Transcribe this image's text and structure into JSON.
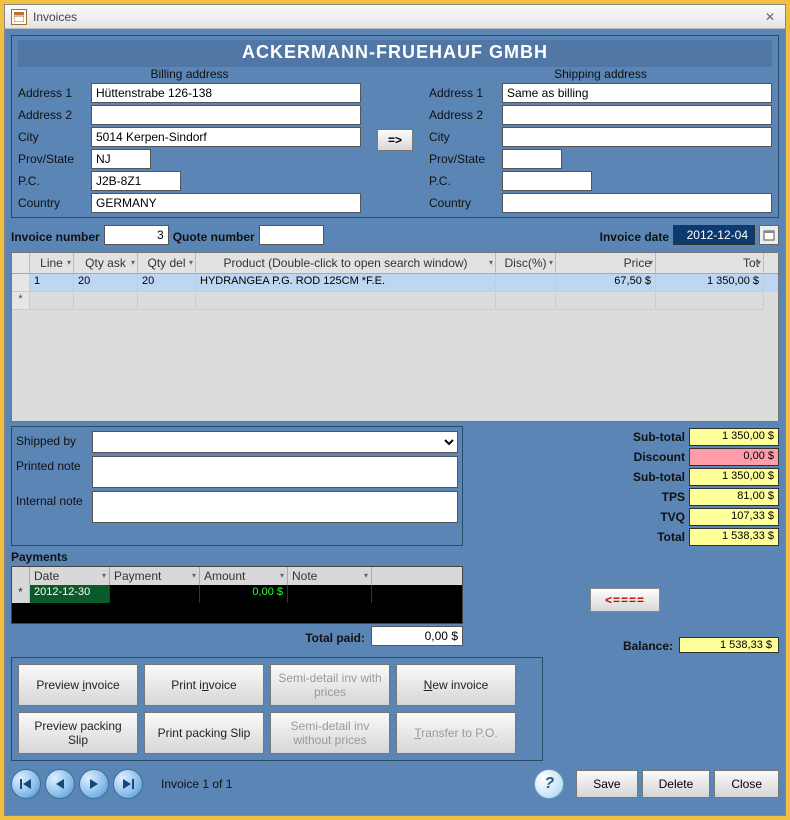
{
  "window": {
    "title": "Invoices",
    "close_glyph": "✕"
  },
  "company_name": "ACKERMANN-FRUEHAUF GMBH",
  "billing": {
    "title": "Billing address",
    "labels": {
      "addr1": "Address 1",
      "addr2": "Address 2",
      "city": "City",
      "prov": "Prov/State",
      "pc": "P.C.",
      "country": "Country"
    },
    "values": {
      "addr1": "Hüttenstrabe 126-138",
      "addr2": "",
      "city": "5014 Kerpen-Sindorf",
      "prov": "NJ",
      "pc": "J2B-8Z1",
      "country": "GERMANY"
    }
  },
  "shipping": {
    "title": "Shipping address",
    "values": {
      "addr1": "Same as billing",
      "addr2": "",
      "city": "",
      "prov": "",
      "pc": "",
      "country": ""
    }
  },
  "copy_arrow": "=>",
  "meta": {
    "invoice_number_label": "Invoice number",
    "invoice_number": "3",
    "quote_number_label": "Quote number",
    "quote_number": "",
    "invoice_date_label": "Invoice date",
    "invoice_date": "2012-12-04"
  },
  "grid": {
    "headers": {
      "line": "Line",
      "qty_ask": "Qty ask",
      "qty_del": "Qty del",
      "product": "Product (Double-click to open search window)",
      "disc": "Disc(%)",
      "price": "Price",
      "tot": "Tot"
    },
    "rows": [
      {
        "line": "1",
        "qty_ask": "20",
        "qty_del": "20",
        "product": "HYDRANGEA P.G. ROD 125CM  *F.E.",
        "disc": "",
        "price": "67,50 $",
        "tot": "1 350,00 $"
      }
    ]
  },
  "notes": {
    "shipped_by_label": "Shipped by",
    "shipped_by": "",
    "printed_label": "Printed note",
    "printed": "",
    "internal_label": "Internal note",
    "internal": ""
  },
  "totals": {
    "subtotal1_label": "Sub-total",
    "subtotal1": "1 350,00 $",
    "discount_label": "Discount",
    "discount": "0,00 $",
    "subtotal2_label": "Sub-total",
    "subtotal2": "1 350,00 $",
    "tps_label": "TPS",
    "tps": "81,00 $",
    "tvq_label": "TVQ",
    "tvq": "107,33 $",
    "total_label": "Total",
    "total": "1 538,33 $"
  },
  "payments": {
    "label": "Payments",
    "headers": {
      "date": "Date",
      "payment": "Payment",
      "amount": "Amount",
      "note": "Note"
    },
    "rows": [
      {
        "date": "2012-12-30",
        "payment": "",
        "amount": "0,00 $",
        "note": ""
      }
    ],
    "total_paid_label": "Total paid:",
    "total_paid": "0,00 $"
  },
  "back_arrow": "<====",
  "balance": {
    "label": "Balance:",
    "value": "1 538,33 $"
  },
  "buttons": {
    "preview_invoice": "Preview invoice",
    "print_invoice": "Print invoice",
    "semi_with": "Semi-detail inv with prices",
    "new_invoice": "New invoice",
    "preview_slip": "Preview packing Slip",
    "print_slip": "Print packing Slip",
    "semi_without": "Semi-detail inv without prices",
    "transfer": "Transfer to P.O."
  },
  "footer": {
    "record": "Invoice 1 of 1",
    "save": "Save",
    "delete": "Delete",
    "close": "Close",
    "help": "?"
  }
}
